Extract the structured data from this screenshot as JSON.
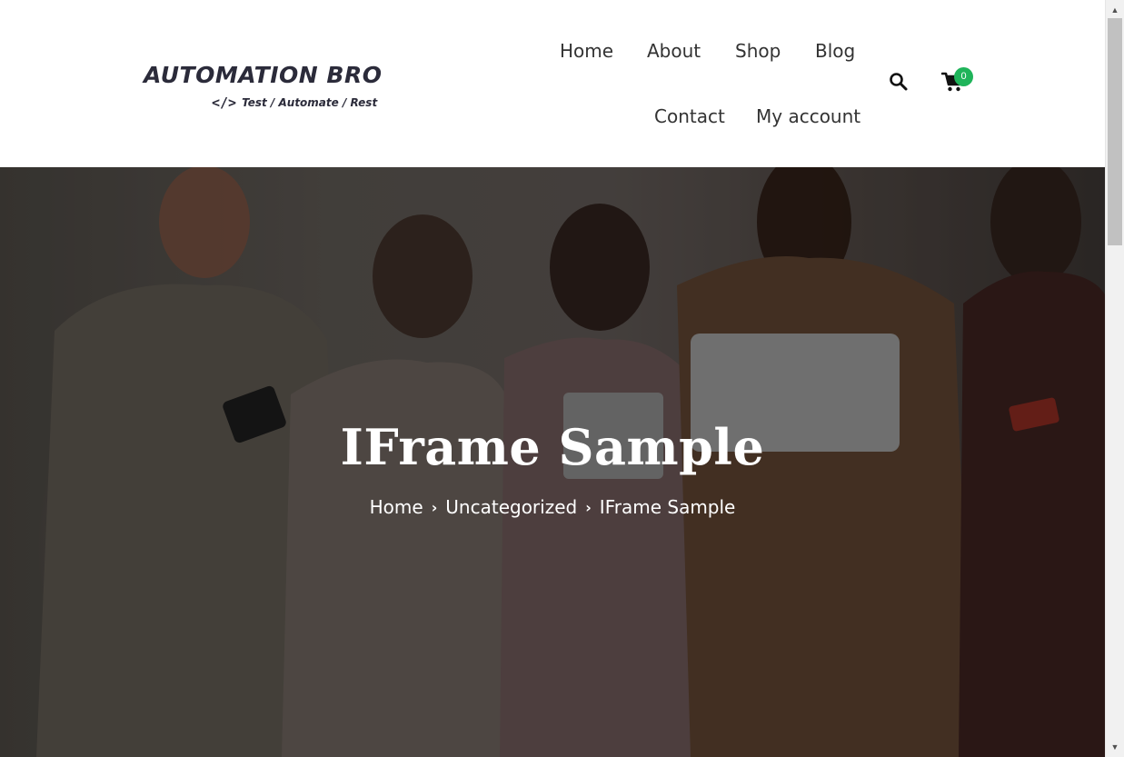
{
  "logo": {
    "title": "AUTOMATION BRO",
    "code_glyph": "</>",
    "tagline": "Test / Automate / Rest"
  },
  "nav": {
    "home": "Home",
    "about": "About",
    "shop": "Shop",
    "blog": "Blog",
    "contact": "Contact",
    "my_account": "My account"
  },
  "icons": {
    "search": "search-icon",
    "cart": "cart-icon"
  },
  "cart": {
    "count": "0",
    "badge_color": "#1fb45a"
  },
  "hero": {
    "title": "IFrame Sample",
    "breadcrumb": {
      "home": "Home",
      "category": "Uncategorized",
      "current": "IFrame Sample"
    }
  },
  "colors": {
    "header_bg": "#ffffff",
    "nav_text": "#333333",
    "hero_text": "#ffffff"
  }
}
